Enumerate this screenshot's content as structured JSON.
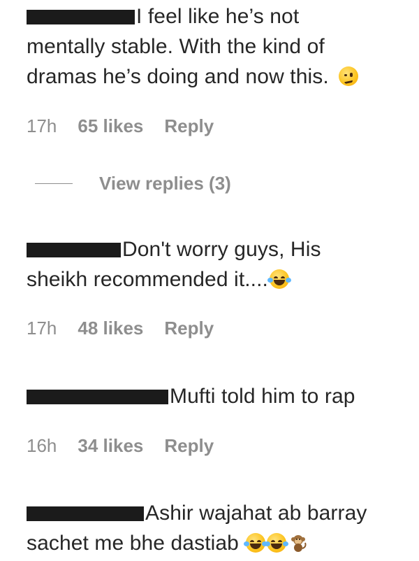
{
  "comments": [
    {
      "text_line1": "I feel like he’s not",
      "text_line2": "mentally stable. With the kind of",
      "text_line3": "dramas he’s doing and now this.",
      "emoji": "woozy-face-icon",
      "time": "17h",
      "likes": "65 likes",
      "reply": "Reply",
      "view_replies": "View replies (3)"
    },
    {
      "text_line1": "Don't worry guys, His",
      "text_line2": "sheikh recommended it....",
      "emoji": "laughing-tears-icon",
      "time": "17h",
      "likes": "48 likes",
      "reply": "Reply"
    },
    {
      "text_line1": "Mufti told him to rap",
      "time": "16h",
      "likes": "34 likes",
      "reply": "Reply"
    },
    {
      "text_line1": "Ashir wajahat ab barray",
      "text_line2": "sachet me bhe dastiab",
      "emojis": [
        "laughing-tears-icon",
        "laughing-tears-icon",
        "monkey-icon"
      ]
    }
  ],
  "colors": {
    "text": "#262626",
    "meta": "#8e8e8e",
    "redaction": "#1b1b1b"
  }
}
